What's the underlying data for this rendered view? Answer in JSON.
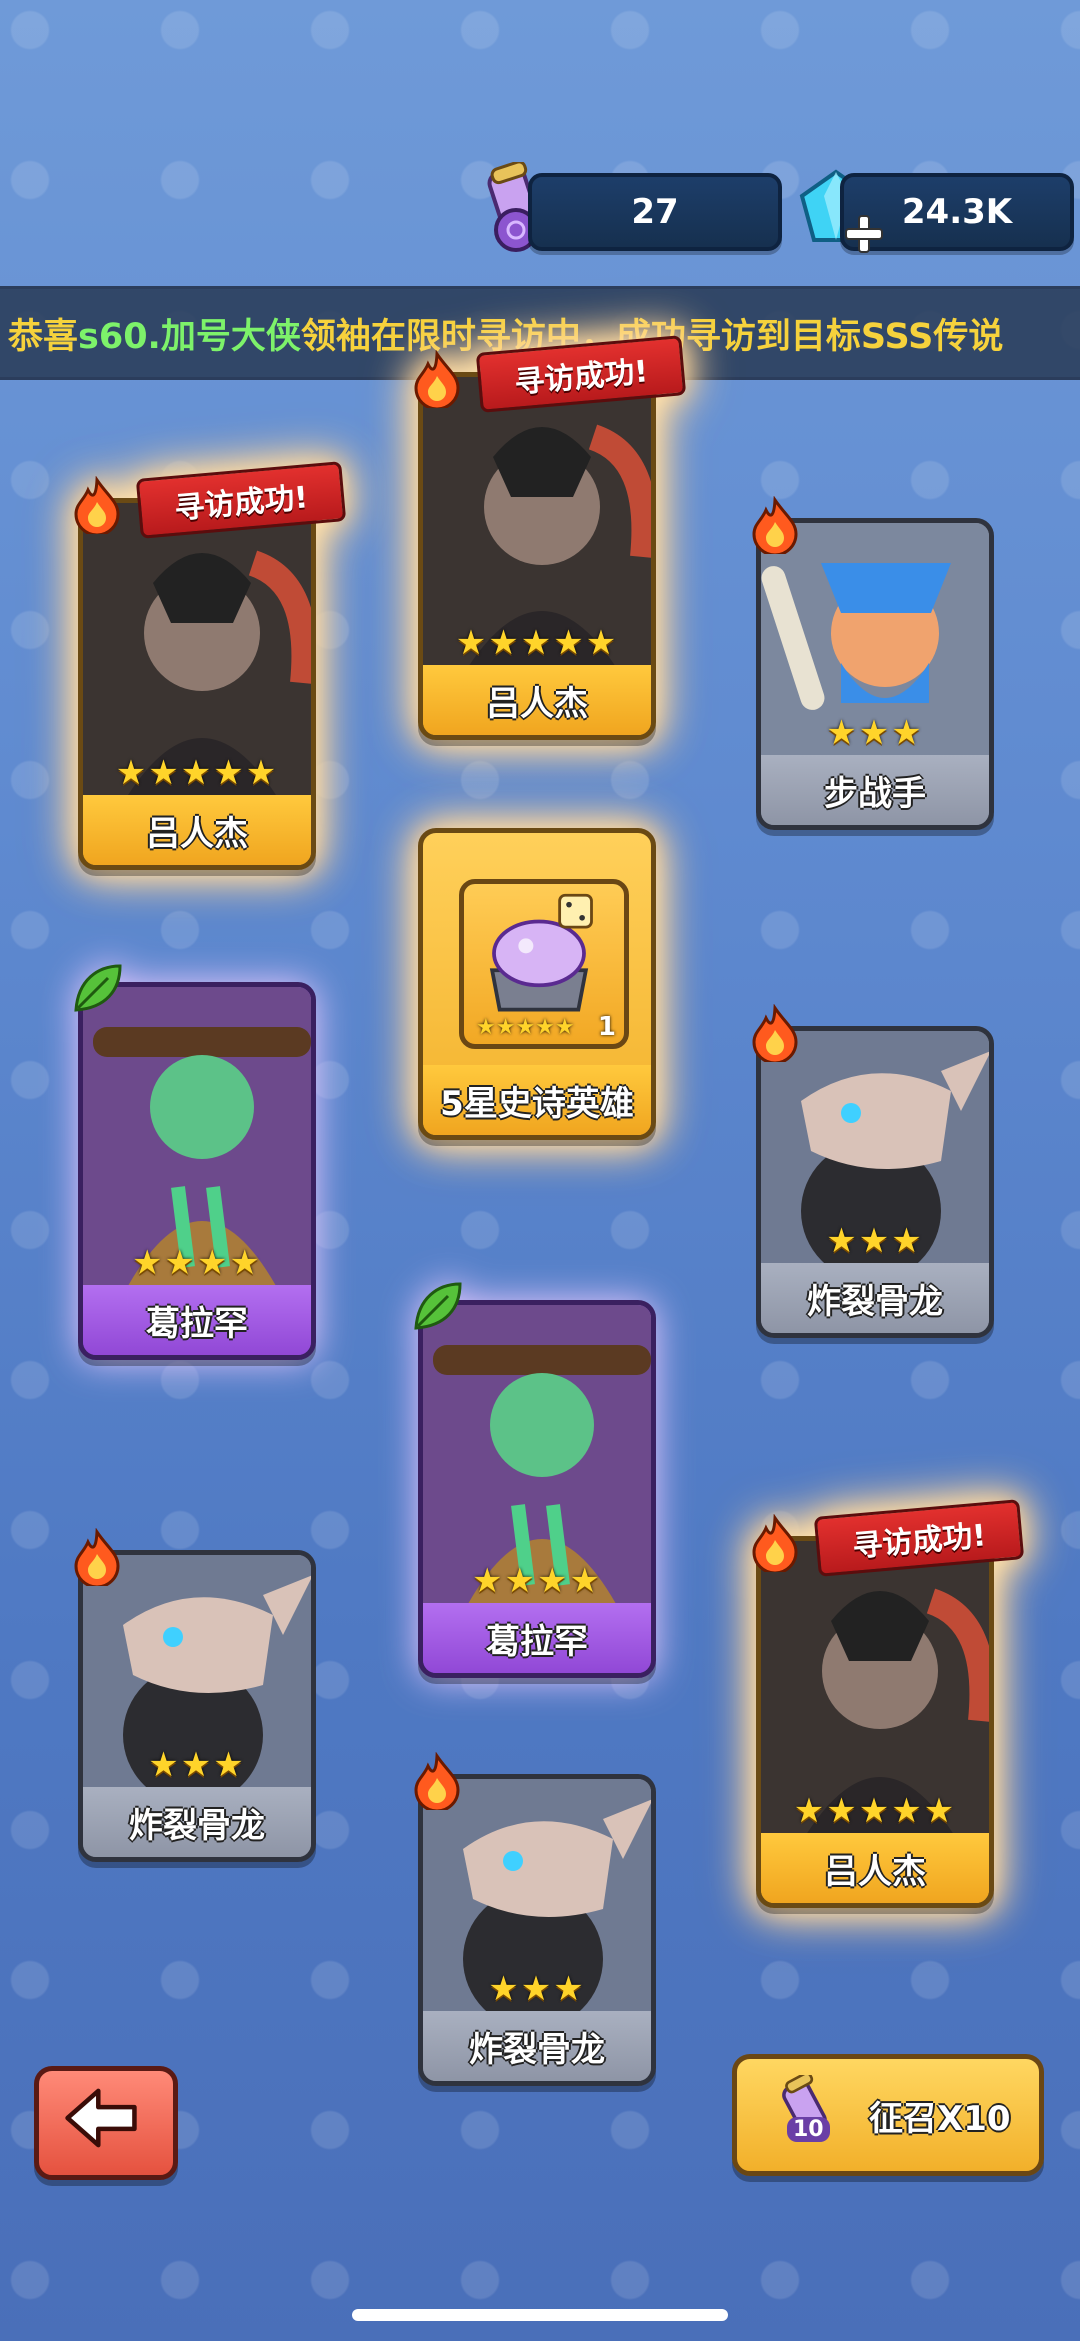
{
  "currency": {
    "scrolls": "27",
    "gems": "24.3K"
  },
  "marquee": {
    "prefix": "恭喜",
    "player": "s60.加号大侠",
    "message": "领袖在限时寻访中，成功寻访到目标SSS传说"
  },
  "cards": [
    {
      "name": "吕人杰",
      "stars": "★★★★★",
      "banner": "寻访成功!"
    },
    {
      "name": "吕人杰",
      "stars": "★★★★★",
      "banner": "寻访成功!"
    },
    {
      "name": "步战手",
      "stars": "★★★"
    },
    {
      "name": "5星史诗英雄",
      "stars": "★★★★★",
      "count": "1"
    },
    {
      "name": "葛拉罕",
      "stars": "★★★★"
    },
    {
      "name": "炸裂骨龙",
      "stars": "★★★"
    },
    {
      "name": "葛拉罕",
      "stars": "★★★★"
    },
    {
      "name": "炸裂骨龙",
      "stars": "★★★"
    },
    {
      "name": "吕人杰",
      "stars": "★★★★★",
      "banner": "寻访成功!"
    },
    {
      "name": "炸裂骨龙",
      "stars": "★★★"
    }
  ],
  "bottom": {
    "recruit_label": "征召X10",
    "recruit_count": "10"
  },
  "colors": {
    "gold": "#f3b22c",
    "purple": "#9148d6",
    "grey": "#8e95a6",
    "fire": "#ff5a1e",
    "leaf": "#56c23a"
  }
}
